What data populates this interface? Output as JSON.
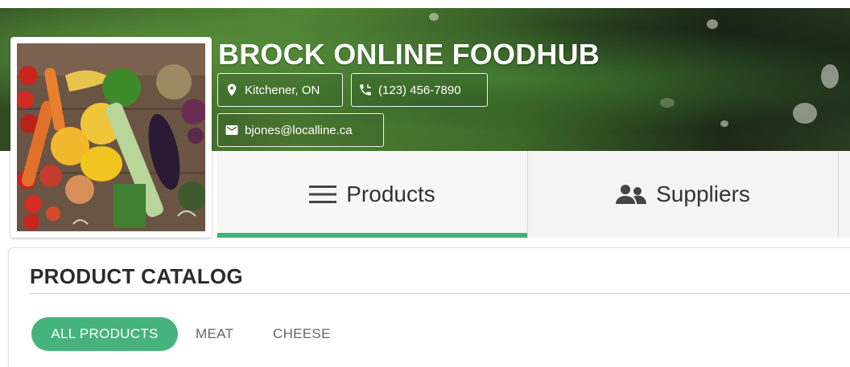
{
  "store": {
    "name": "BROCK ONLINE FOODHUB",
    "location": "Kitchener, ON",
    "phone": "(123) 456-7890",
    "email": "bjones@localline.ca"
  },
  "tabs": [
    {
      "label": "Products",
      "icon": "menu-icon",
      "active": true
    },
    {
      "label": "Suppliers",
      "icon": "people-icon",
      "active": false
    }
  ],
  "catalog": {
    "title": "PRODUCT CATALOG",
    "filters": [
      "ALL PRODUCTS",
      "MEAT",
      "CHEESE"
    ],
    "active_filter": "ALL PRODUCTS"
  },
  "colors": {
    "accent": "#3db37a",
    "chip_active": "#46b37c"
  }
}
